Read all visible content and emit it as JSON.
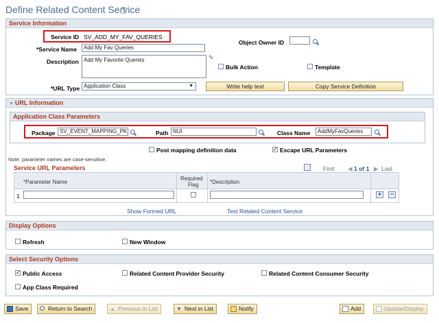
{
  "page": {
    "title": "Define Related Content Service"
  },
  "service_info": {
    "header": "Service Information",
    "service_id_label": "Service ID",
    "service_id_value": "SV_ADD_MY_FAV_QUERIES",
    "service_name_label": "*Service Name",
    "service_name_value": "Add My Fav Queries",
    "description_label": "Description",
    "description_value": "Add My Favorite Queries",
    "object_owner_label": "Object Owner ID",
    "object_owner_value": "",
    "bulk_action_label": "Bulk Action",
    "template_label": "Template",
    "url_type_label": "*URL Type",
    "url_type_value": "Application Class",
    "write_help_label": "Write help text",
    "copy_def_label": "Copy Service Definition"
  },
  "url_info": {
    "header": "URL Information",
    "app_class_header": "Application Class Parameters",
    "package_label": "Package",
    "package_value": "SV_EVENT_MAPPING_PK",
    "path_label": "Path",
    "path_value": "NUI",
    "class_name_label": "Class Name",
    "class_name_value": "AddMyFavQueries",
    "note": "Note: parameter names are case-sensitive.",
    "post_mapping_label": "Post mapping definition data",
    "escape_url_label": "Escape URL Parameters"
  },
  "service_url_params": {
    "header": "Service URL Parameters",
    "first_label": "First",
    "page_info": "1 of 1",
    "last_label": "Last",
    "col_param_name": "*Parameter Name",
    "col_required_1": "Required",
    "col_required_2": "Flag",
    "col_description": "*Description",
    "rows": [
      {
        "num": "1",
        "param_name": "",
        "description": ""
      }
    ],
    "show_formed_url": "Show Formed URL",
    "test_service": "Test Related Content Service"
  },
  "display_options": {
    "header": "Display Options",
    "refresh_label": "Refresh",
    "new_window_label": "New Window"
  },
  "security_options": {
    "header": "Select Security Options",
    "public_access_label": "Public Access",
    "provider_security_label": "Related Content Provider Security",
    "consumer_security_label": "Related Content Consumer Security",
    "app_class_required_label": "App Class Required"
  },
  "toolbar": {
    "save": "Save",
    "return_to_search": "Return to Search",
    "previous_in_list": "Previous in List",
    "next_in_list": "Next in List",
    "notify": "Notify",
    "add": "Add",
    "update_display": "Update/Display"
  },
  "colors": {
    "title": "#4b6d96",
    "section_header": "#a93c1f",
    "highlight": "#d01a1a",
    "link": "#264f8e"
  }
}
